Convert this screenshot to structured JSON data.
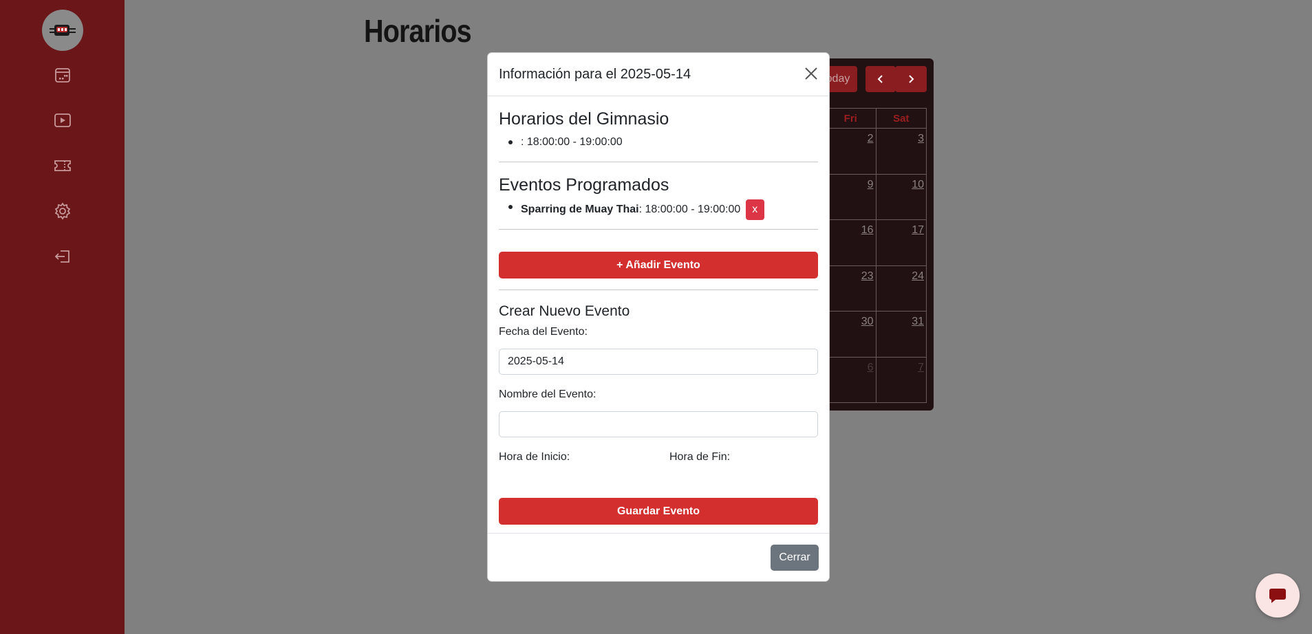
{
  "page": {
    "title": "Horarios"
  },
  "sidebar": {
    "icons": [
      "logo-icon",
      "calendar-icon",
      "play-icon",
      "ticket-icon",
      "gear-icon",
      "logout-icon"
    ]
  },
  "calendar": {
    "today_label": "oday",
    "prev_label": "‹",
    "next_label": "›",
    "headers": [
      "Fri",
      "Sat"
    ],
    "rows": [
      [
        "2",
        "3"
      ],
      [
        "9",
        "10"
      ],
      [
        "16",
        "17"
      ],
      [
        "23",
        "24"
      ],
      [
        "30",
        "31"
      ],
      [
        "6",
        "7"
      ]
    ]
  },
  "modal": {
    "title": "Información para el 2025-05-14",
    "gym_hours_heading": "Horarios del Gimnasio",
    "gym_hours": [
      ": 18:00:00 - 19:00:00"
    ],
    "events_heading": "Eventos Programados",
    "events": [
      {
        "name": "Sparring de Muay Thai",
        "time": ": 18:00:00 - 19:00:00",
        "delete_label": "x"
      }
    ],
    "add_event_label": "+ Añadir Evento",
    "form": {
      "heading": "Crear Nuevo Evento",
      "date_label": "Fecha del Evento:",
      "date_value": "2025-05-14",
      "name_label": "Nombre del Evento:",
      "name_value": "",
      "start_label": "Hora de Inicio:",
      "end_label": "Hora de Fin:",
      "save_label": "Guardar Evento"
    },
    "close_label": "Cerrar"
  },
  "colors": {
    "sidebar": "#6b1719",
    "accent": "#d42f2f",
    "overlay": "#808080"
  }
}
